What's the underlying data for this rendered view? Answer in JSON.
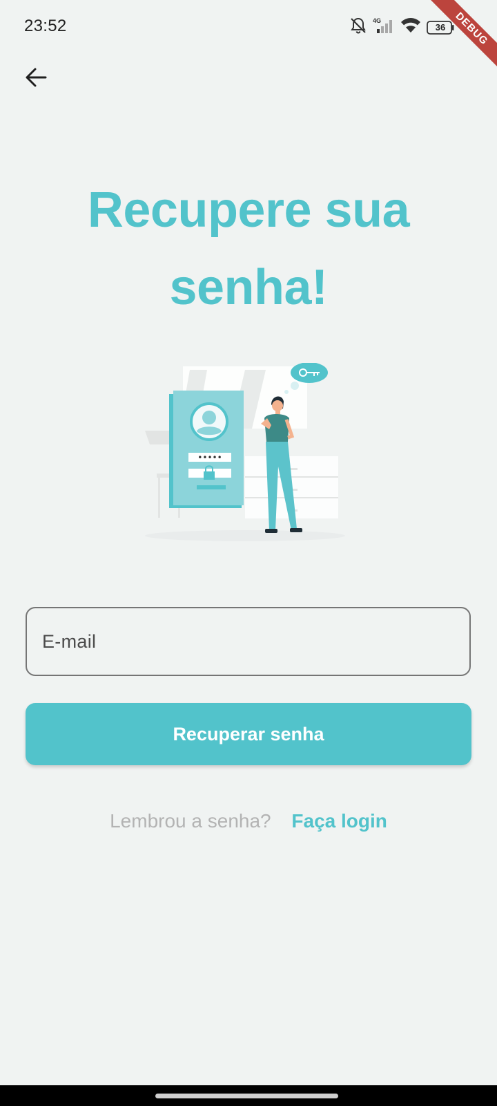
{
  "status_bar": {
    "time": "23:52",
    "network": "4G",
    "battery": "36",
    "icons": [
      "notifications-off-icon",
      "signal-icon",
      "wifi-icon",
      "battery-icon"
    ]
  },
  "debug_banner": "DEBUG",
  "header": {
    "back_icon": "arrow-left-icon"
  },
  "main": {
    "title": "Recupere sua senha!",
    "illustration": "forgot-password-illustration",
    "illustration_password_dots": "•••••",
    "email_field": {
      "placeholder": "E-mail",
      "value": ""
    },
    "recover_button_label": "Recuperar senha",
    "login_prompt": "Lembrou a senha?",
    "login_link": "Faça login"
  },
  "colors": {
    "accent": "#52c3cb",
    "background": "#f0f3f2",
    "muted_text": "#b3b3b3",
    "field_border": "#757575"
  }
}
